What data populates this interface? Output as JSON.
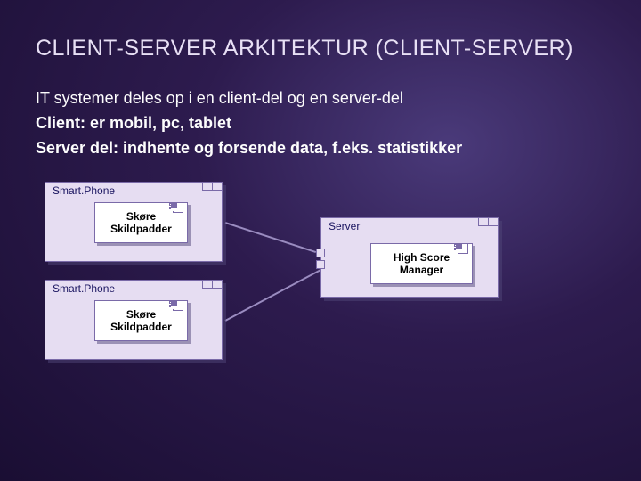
{
  "title": "CLIENT-SERVER ARKITEKTUR  (CLIENT-SERVER)",
  "bullets": {
    "line1": "IT systemer deles op i en client-del og en server-del",
    "line2": "Client: er mobil, pc, tablet",
    "line3": "Server del: indhente og forsende data, f.eks. statistikker"
  },
  "diagram": {
    "client1": {
      "node_label": "Smart.Phone",
      "component": "Skøre\nSkildpadder"
    },
    "client2": {
      "node_label": "Smart.Phone",
      "component": "Skøre\nSkildpadder"
    },
    "server": {
      "node_label": "Server",
      "component": "High Score\nManager"
    }
  }
}
